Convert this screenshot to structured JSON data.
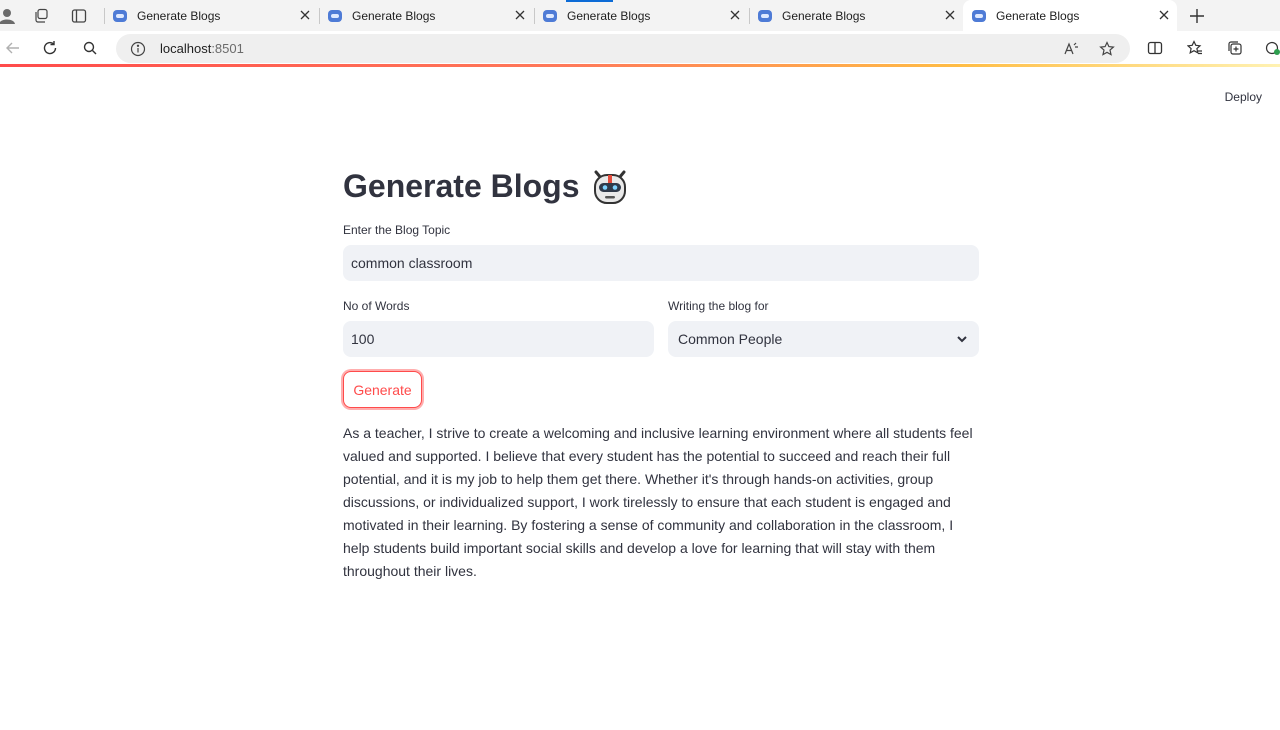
{
  "browser": {
    "tabs": [
      {
        "title": "Generate Blogs",
        "active": false
      },
      {
        "title": "Generate Blogs",
        "active": false
      },
      {
        "title": "Generate Blogs",
        "active": false
      },
      {
        "title": "Generate Blogs",
        "active": false
      },
      {
        "title": "Generate Blogs",
        "active": true
      }
    ],
    "address": {
      "host": "localhost",
      "port": ":8501"
    },
    "icons": {
      "profile": "profile-icon",
      "workspaces": "workspaces-icon",
      "tab_actions": "tab-actions-icon",
      "back": "back-arrow-icon",
      "refresh": "refresh-icon",
      "search": "search-icon",
      "site_info": "info-icon",
      "read_aloud": "read-aloud-icon",
      "favorite": "star-icon",
      "split": "split-screen-icon",
      "favorites": "favorites-icon",
      "collections": "collections-icon",
      "extension": "extension-icon",
      "new_tab": "plus-icon",
      "close_tab": "close-icon"
    },
    "accent": "#0c6bd6"
  },
  "app": {
    "deploy_label": "Deploy",
    "title": "Generate Blogs",
    "title_emoji": "robot-face-icon",
    "topic": {
      "label": "Enter the Blog Topic",
      "value": "common classroom"
    },
    "words": {
      "label": "No of Words",
      "value": "100"
    },
    "audience": {
      "label": "Writing the blog for",
      "value": "Common People"
    },
    "generate_label": "Generate",
    "output_text": "As a teacher, I strive to create a welcoming and inclusive learning environment where all students feel valued and supported. I believe that every student has the potential to succeed and reach their full potential, and it is my job to help them get there. Whether it's through hands-on activities, group discussions, or individualized support, I work tirelessly to ensure that each student is engaged and motivated in their learning. By fostering a sense of community and collaboration in the classroom, I help students build important social skills and develop a love for learning that will stay with them throughout their lives.",
    "colors": {
      "primary": "#ff4b4b",
      "input_bg": "#f0f2f6",
      "text": "#31333f"
    }
  }
}
